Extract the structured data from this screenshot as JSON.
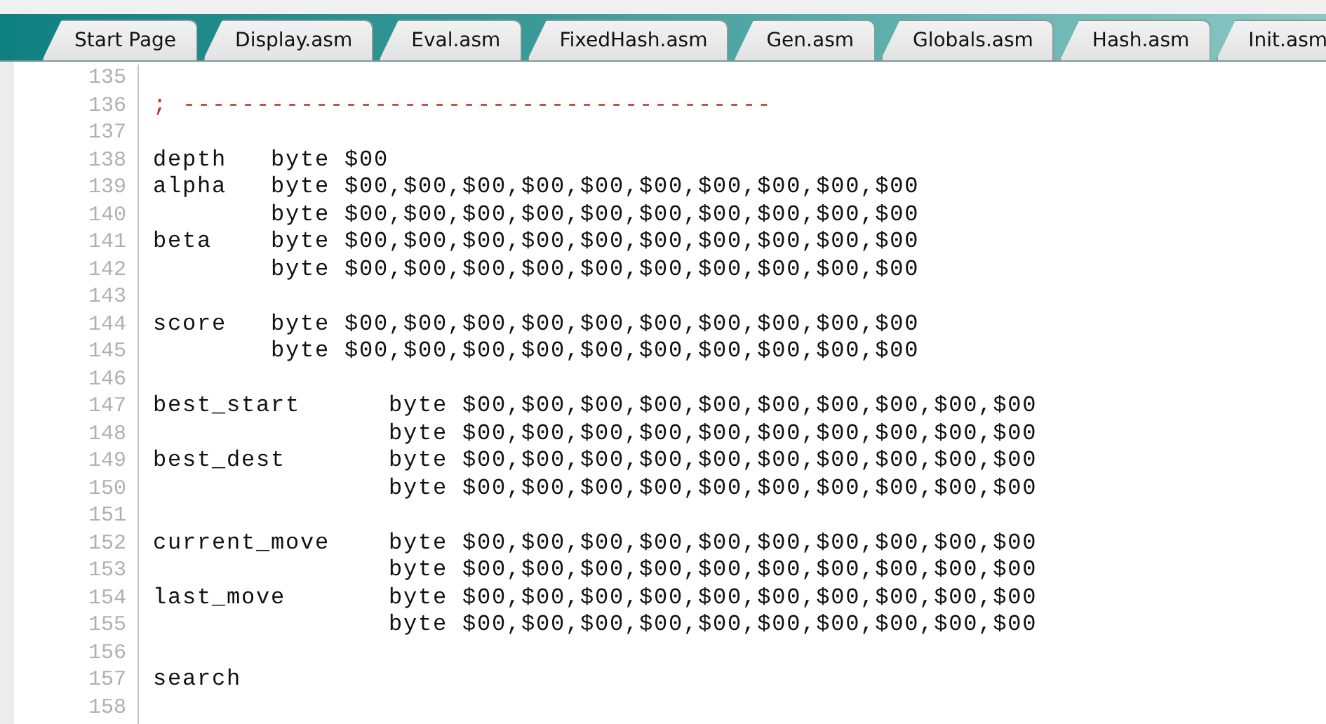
{
  "tabs": [
    {
      "label": "Start Page",
      "selected": false
    },
    {
      "label": "Display.asm",
      "selected": false
    },
    {
      "label": "Eval.asm",
      "selected": false
    },
    {
      "label": "FixedHash.asm",
      "selected": false
    },
    {
      "label": "Gen.asm",
      "selected": false
    },
    {
      "label": "Globals.asm",
      "selected": false
    },
    {
      "label": "Hash.asm",
      "selected": false
    },
    {
      "label": "Init.asm",
      "selected": false
    }
  ],
  "editor": {
    "lines": [
      {
        "number": "135",
        "kind": "blank"
      },
      {
        "number": "136",
        "kind": "comment",
        "text": "; ----------------------------------------"
      },
      {
        "number": "137",
        "kind": "blank"
      },
      {
        "number": "138",
        "kind": "code",
        "text": "depth   byte $00"
      },
      {
        "number": "139",
        "kind": "code",
        "text": "alpha   byte $00,$00,$00,$00,$00,$00,$00,$00,$00,$00"
      },
      {
        "number": "140",
        "kind": "code",
        "text": "        byte $00,$00,$00,$00,$00,$00,$00,$00,$00,$00"
      },
      {
        "number": "141",
        "kind": "code",
        "text": "beta    byte $00,$00,$00,$00,$00,$00,$00,$00,$00,$00"
      },
      {
        "number": "142",
        "kind": "code",
        "text": "        byte $00,$00,$00,$00,$00,$00,$00,$00,$00,$00"
      },
      {
        "number": "143",
        "kind": "blank"
      },
      {
        "number": "144",
        "kind": "code",
        "text": "score   byte $00,$00,$00,$00,$00,$00,$00,$00,$00,$00"
      },
      {
        "number": "145",
        "kind": "code",
        "text": "        byte $00,$00,$00,$00,$00,$00,$00,$00,$00,$00"
      },
      {
        "number": "146",
        "kind": "blank"
      },
      {
        "number": "147",
        "kind": "code",
        "text": "best_start      byte $00,$00,$00,$00,$00,$00,$00,$00,$00,$00"
      },
      {
        "number": "148",
        "kind": "code",
        "text": "                byte $00,$00,$00,$00,$00,$00,$00,$00,$00,$00"
      },
      {
        "number": "149",
        "kind": "code",
        "text": "best_dest       byte $00,$00,$00,$00,$00,$00,$00,$00,$00,$00"
      },
      {
        "number": "150",
        "kind": "code",
        "text": "                byte $00,$00,$00,$00,$00,$00,$00,$00,$00,$00"
      },
      {
        "number": "151",
        "kind": "blank"
      },
      {
        "number": "152",
        "kind": "code",
        "text": "current_move    byte $00,$00,$00,$00,$00,$00,$00,$00,$00,$00"
      },
      {
        "number": "153",
        "kind": "code",
        "text": "                byte $00,$00,$00,$00,$00,$00,$00,$00,$00,$00"
      },
      {
        "number": "154",
        "kind": "code",
        "text": "last_move       byte $00,$00,$00,$00,$00,$00,$00,$00,$00,$00"
      },
      {
        "number": "155",
        "kind": "code",
        "text": "                byte $00,$00,$00,$00,$00,$00,$00,$00,$00,$00"
      },
      {
        "number": "156",
        "kind": "blank"
      },
      {
        "number": "157",
        "kind": "code",
        "text": "search"
      },
      {
        "number": "158",
        "kind": "blank"
      }
    ]
  }
}
